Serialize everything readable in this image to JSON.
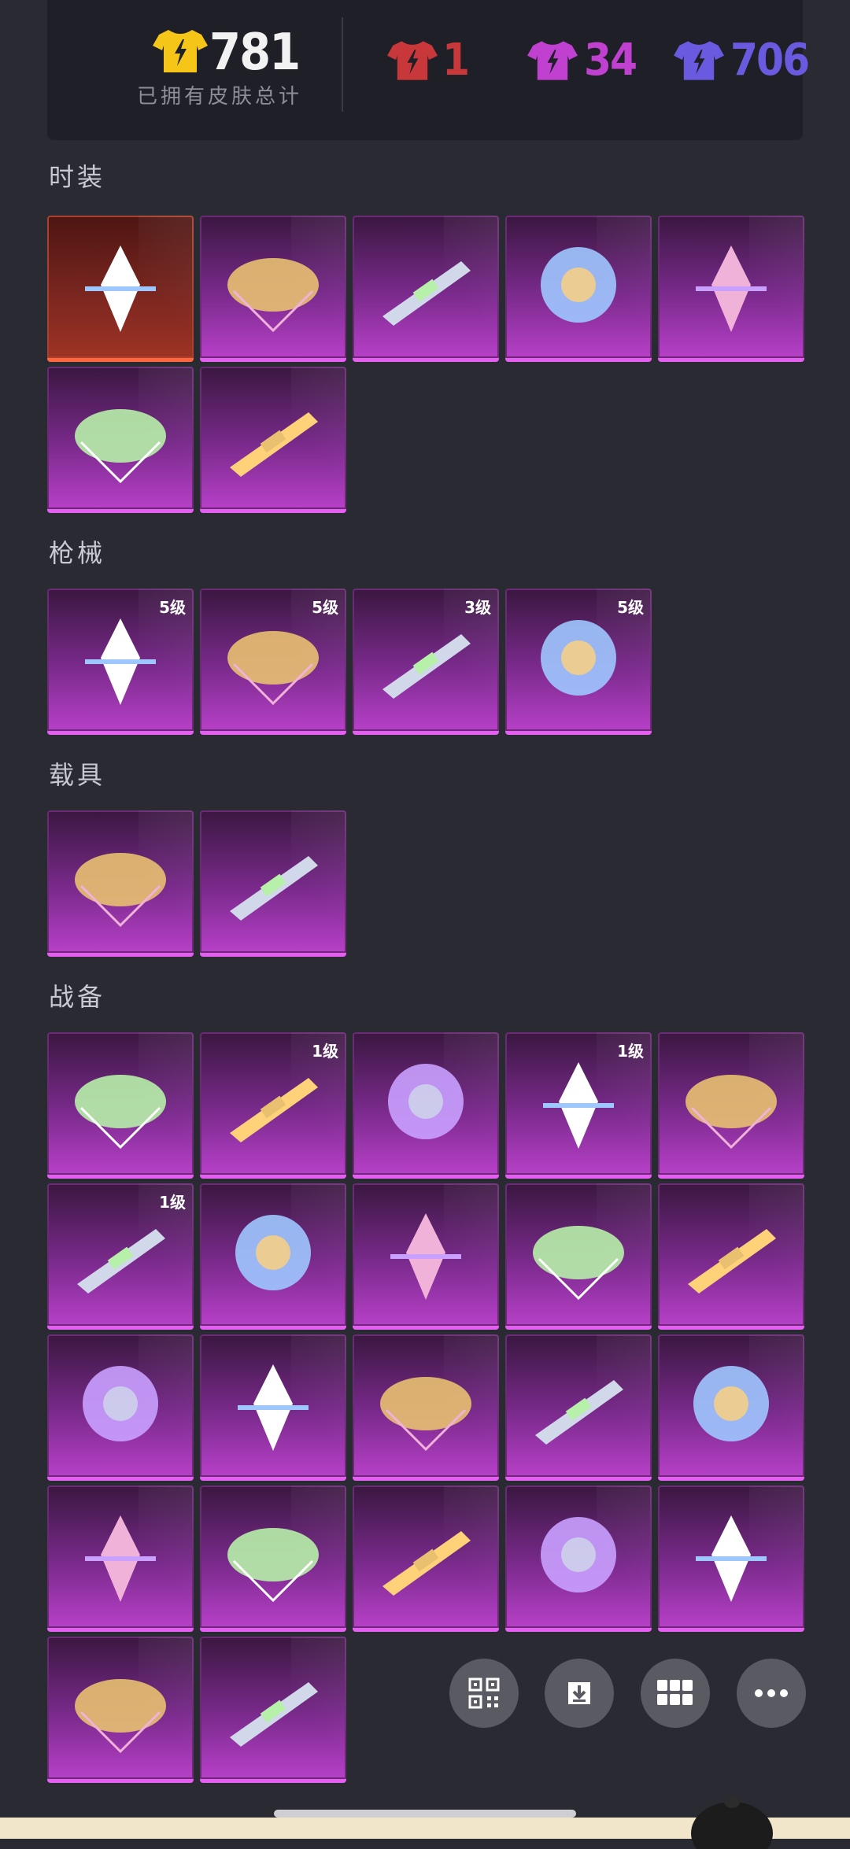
{
  "summary": {
    "total_count": "781",
    "total_caption": "已拥有皮肤总计",
    "rarities": [
      {
        "name": "red",
        "count": "1",
        "color": "#c8383a"
      },
      {
        "name": "purple",
        "count": "34",
        "color": "#c040d0"
      },
      {
        "name": "blue",
        "count": "706",
        "color": "#6a5ae0"
      }
    ],
    "gold_color": "#f5c518"
  },
  "sections": {
    "outfits": {
      "title": "时装",
      "items": [
        {
          "name": "mummy-outfit",
          "rarity": "red",
          "level": ""
        },
        {
          "name": "puffer-jacket-pair",
          "rarity": "purple",
          "level": ""
        },
        {
          "name": "white-robe-pair",
          "rarity": "purple",
          "level": ""
        },
        {
          "name": "blue-dress-outfit",
          "rarity": "purple",
          "level": ""
        },
        {
          "name": "silver-armor-pair",
          "rarity": "purple",
          "level": ""
        },
        {
          "name": "white-suit-pair",
          "rarity": "purple",
          "level": ""
        },
        {
          "name": "dark-armor-pair",
          "rarity": "purple",
          "level": ""
        }
      ]
    },
    "weapons": {
      "title": "枪械",
      "items": [
        {
          "name": "gold-rifle",
          "rarity": "purple",
          "level": "5级"
        },
        {
          "name": "kar98-rifle",
          "rarity": "purple",
          "level": "5级"
        },
        {
          "name": "dark-rifle",
          "rarity": "purple",
          "level": "3级"
        },
        {
          "name": "pink-rifle",
          "rarity": "purple",
          "level": "5级"
        }
      ]
    },
    "vehicles": {
      "title": "载具",
      "items": [
        {
          "name": "golden-qilin",
          "rarity": "purple",
          "level": ""
        },
        {
          "name": "silver-sports-car",
          "rarity": "purple",
          "level": ""
        }
      ]
    },
    "gear": {
      "title": "战备",
      "items": [
        {
          "name": "blue-parachute",
          "rarity": "purple",
          "level": ""
        },
        {
          "name": "black-dragon",
          "rarity": "purple",
          "level": "1级"
        },
        {
          "name": "red-blade-glider",
          "rarity": "purple",
          "level": ""
        },
        {
          "name": "green-jet-glider",
          "rarity": "purple",
          "level": "1级"
        },
        {
          "name": "jade-wing-glider",
          "rarity": "purple",
          "level": ""
        },
        {
          "name": "pegasus-chariot",
          "rarity": "purple",
          "level": "1级"
        },
        {
          "name": "gold-fan-parachute",
          "rarity": "purple",
          "level": ""
        },
        {
          "name": "crystal-shards-glider",
          "rarity": "purple",
          "level": ""
        },
        {
          "name": "bear-balloon",
          "rarity": "purple",
          "level": ""
        },
        {
          "name": "floral-wing-glider",
          "rarity": "purple",
          "level": ""
        },
        {
          "name": "black-gold-parachute",
          "rarity": "purple",
          "level": ""
        },
        {
          "name": "pink-parachute",
          "rarity": "purple",
          "level": ""
        },
        {
          "name": "green-leaf-parachute",
          "rarity": "purple",
          "level": ""
        },
        {
          "name": "sky-dome-parachute",
          "rarity": "purple",
          "level": ""
        },
        {
          "name": "pink-fairy-glider",
          "rarity": "purple",
          "level": ""
        },
        {
          "name": "purple-wave-parachute",
          "rarity": "purple",
          "level": ""
        },
        {
          "name": "silver-wing-glider",
          "rarity": "purple",
          "level": ""
        },
        {
          "name": "toy-box-parachute",
          "rarity": "purple",
          "level": ""
        },
        {
          "name": "white-bunny-parachute",
          "rarity": "purple",
          "level": ""
        },
        {
          "name": "ufo-glider",
          "rarity": "purple",
          "level": ""
        },
        {
          "name": "rainbow-ring-glider",
          "rarity": "purple",
          "level": ""
        },
        {
          "name": "golden-cloud",
          "rarity": "purple",
          "level": ""
        }
      ]
    }
  },
  "actions": [
    {
      "name": "qr-code-button",
      "icon": "qr-code-icon"
    },
    {
      "name": "download-button",
      "icon": "download-icon"
    },
    {
      "name": "grid-button",
      "icon": "grid-icon"
    },
    {
      "name": "more-button",
      "icon": "more-icon"
    }
  ]
}
